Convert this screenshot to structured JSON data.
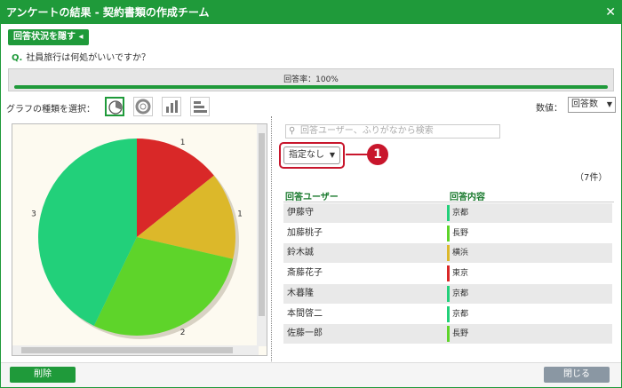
{
  "window": {
    "title": "アンケートの結果 - 契約書類の作成チーム",
    "close_glyph": "✕"
  },
  "toggle_button": {
    "label": "回答状況を隠す ◂"
  },
  "question": {
    "prefix": "Q.",
    "text": "社員旅行は何処がいいですか？"
  },
  "response_rate": {
    "label": "回答率：100%",
    "value": 1.0
  },
  "chart_type": {
    "label": "グラフの種類を選択：",
    "options": [
      "pie-chart-icon",
      "donut-chart-icon",
      "bar-chart-icon",
      "horizontal-bar-chart-icon"
    ],
    "selected": "pie-chart-icon"
  },
  "value_select": {
    "label": "数値：",
    "selected": "回答数"
  },
  "search": {
    "placeholder": "回答ユーザー、ふりがなから検索"
  },
  "filter": {
    "selected": "指定なし"
  },
  "callout": {
    "number": "1"
  },
  "count": "（7件）",
  "table": {
    "headers": [
      "回答ユーザー",
      "回答内容"
    ],
    "rows": [
      {
        "user": "伊藤守",
        "place": "京都",
        "color": "#22d07a"
      },
      {
        "user": "加藤桃子",
        "place": "長野",
        "color": "#5ed42a"
      },
      {
        "user": "鈴木誠",
        "place": "横浜",
        "color": "#dcb82a"
      },
      {
        "user": "斎藤花子",
        "place": "東京",
        "color": "#d92828"
      },
      {
        "user": "木暮隆",
        "place": "京都",
        "color": "#22d07a"
      },
      {
        "user": "本間啓二",
        "place": "京都",
        "color": "#22d07a"
      },
      {
        "user": "佐藤一郎",
        "place": "長野",
        "color": "#5ed42a"
      }
    ]
  },
  "chart_data": {
    "type": "pie",
    "slices": [
      {
        "value": 1,
        "label": "1",
        "color": "#d92828"
      },
      {
        "value": 1,
        "label": "1",
        "color": "#dcb82a"
      },
      {
        "value": 2,
        "label": "2",
        "color": "#5ed42a"
      },
      {
        "value": 3,
        "label": "3",
        "color": "#22d07a"
      }
    ]
  },
  "footer": {
    "delete_label": "削除",
    "close_label": "閉じる"
  }
}
